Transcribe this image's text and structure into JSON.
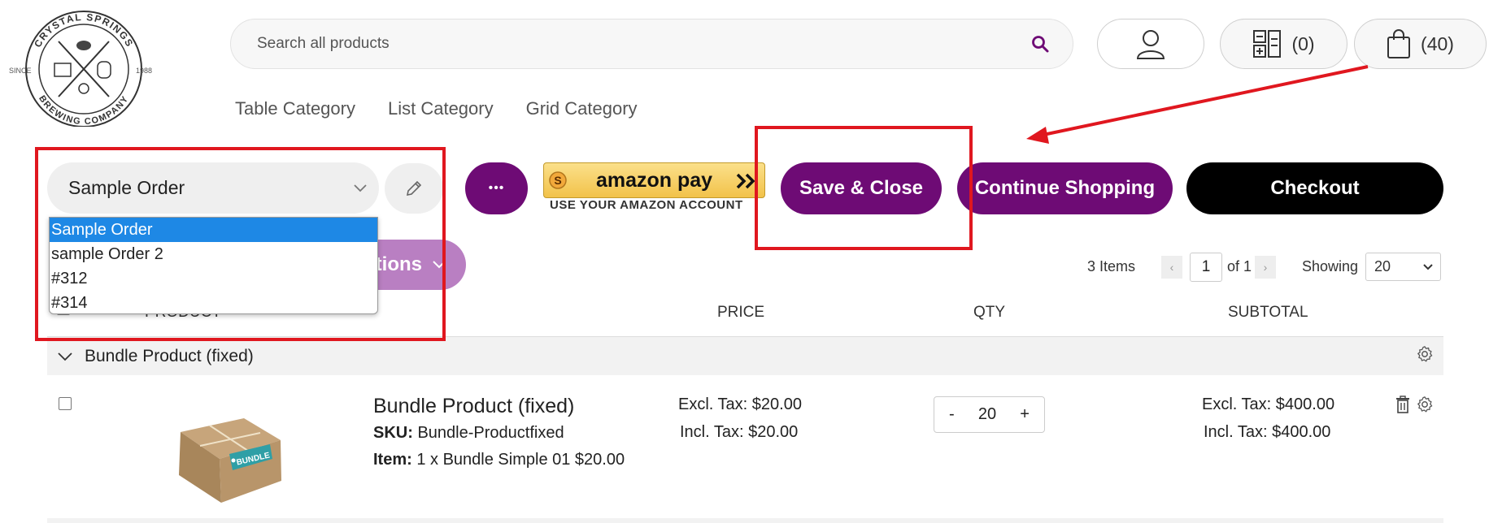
{
  "brand": {
    "logo_text_top": "CRYSTAL SPRINGS",
    "logo_text_bottom": "BREWING COMPANY",
    "logo_since": "SINCE",
    "logo_year": "1988"
  },
  "search": {
    "placeholder": "Search all products"
  },
  "header": {
    "compare_count": "(0)",
    "cart_count": "(40)"
  },
  "nav": [
    "Table Category",
    "List Category",
    "Grid Category"
  ],
  "order_toolbar": {
    "selected_order": "Sample Order",
    "more_label": "•••",
    "amazon_label": "amazon pay",
    "amazon_sub": "USE YOUR AMAZON ACCOUNT",
    "save_close": "Save & Close",
    "continue": "Continue Shopping",
    "checkout": "Checkout",
    "actions_visible": "tions"
  },
  "dropdown": {
    "options": [
      "Sample Order",
      "sample Order 2",
      "#312",
      "#314"
    ],
    "selected_index": 0
  },
  "pagination": {
    "items": "3 Items",
    "page": "1",
    "of": "of 1",
    "showing_label": "Showing",
    "per_page": "20"
  },
  "table": {
    "headers": {
      "product": "PRODUCT",
      "price": "PRICE",
      "qty": "QTY",
      "subtotal": "SUBTOTAL"
    },
    "group_label": "Bundle Product (fixed)",
    "rows": [
      {
        "name": "Bundle Product (fixed)",
        "sku_label": "SKU:",
        "sku": "Bundle-Productfixed",
        "item_label": "Item:",
        "item": "1 x Bundle Simple 01 $20.00",
        "price_excl": "Excl. Tax: $20.00",
        "price_incl": "Incl. Tax: $20.00",
        "qty": "20",
        "qty_minus": "-",
        "qty_plus": "+",
        "subtotal_excl": "Excl. Tax: $400.00",
        "subtotal_incl": "Incl. Tax: $400.00",
        "tag_text": "BUNDLE"
      }
    ]
  },
  "colors": {
    "primary": "#6e0b75",
    "dark": "#000000",
    "annotation": "#e0171f",
    "select_highlight": "#1e88e5"
  }
}
